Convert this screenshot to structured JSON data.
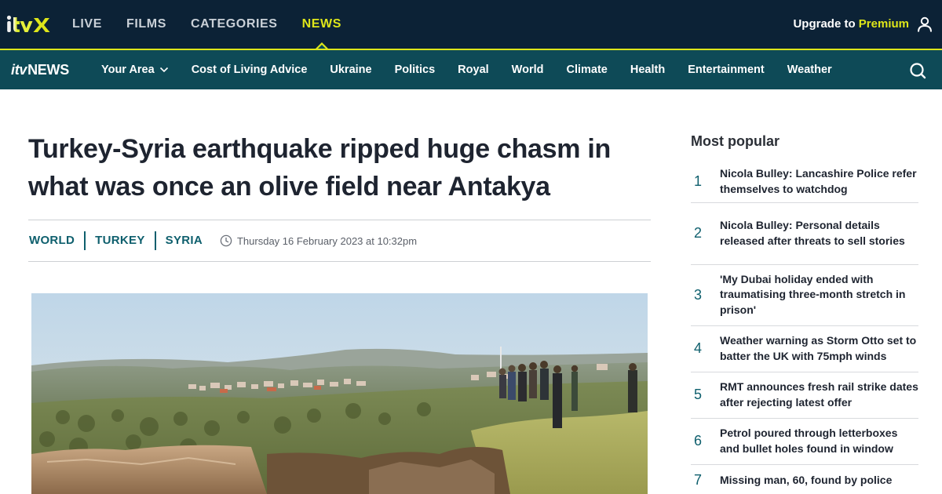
{
  "topbar": {
    "logo_text": "itvX",
    "nav": [
      {
        "label": "LIVE",
        "active": false
      },
      {
        "label": "FILMS",
        "active": false
      },
      {
        "label": "CATEGORIES",
        "active": false
      },
      {
        "label": "NEWS",
        "active": true
      }
    ],
    "upgrade_prefix": "Upgrade to ",
    "upgrade_premium": "Premium",
    "user_icon": "user-icon"
  },
  "newsbar": {
    "logo_itv": "itv",
    "logo_news": "NEWS",
    "items": [
      {
        "label": "Your Area",
        "has_dropdown": true
      },
      {
        "label": "Cost of Living Advice"
      },
      {
        "label": "Ukraine"
      },
      {
        "label": "Politics"
      },
      {
        "label": "Royal"
      },
      {
        "label": "World"
      },
      {
        "label": "Climate"
      },
      {
        "label": "Health"
      },
      {
        "label": "Entertainment"
      },
      {
        "label": "Weather"
      }
    ],
    "search_icon": "search-icon"
  },
  "article": {
    "headline": "Turkey-Syria earthquake ripped huge chasm in what was once an olive field near Antakya",
    "tags": [
      "WORLD",
      "TURKEY",
      "SYRIA"
    ],
    "date": "Thursday 16 February 2023 at 10:32pm",
    "image_icon": "hero-photo"
  },
  "most_popular": {
    "title": "Most popular",
    "items": [
      {
        "rank": "1",
        "text": "Nicola Bulley: Lancashire Police refer themselves to watchdog"
      },
      {
        "rank": "2",
        "text": "Nicola Bulley: Personal details released after threats to sell stories"
      },
      {
        "rank": "3",
        "text": "'My Dubai holiday ended with traumatising three-month stretch in prison'"
      },
      {
        "rank": "4",
        "text": "Weather warning as Storm Otto set to batter the UK with 75mph winds"
      },
      {
        "rank": "5",
        "text": "RMT announces fresh rail strike dates after rejecting latest offer"
      },
      {
        "rank": "6",
        "text": "Petrol poured through letterboxes and bullet holes found in window"
      },
      {
        "rank": "7",
        "text": "Missing man, 60, found by police"
      }
    ]
  },
  "colors": {
    "topbar_bg": "#0c2236",
    "newsbar_bg": "#0e4a57",
    "accent_yellow": "#dee61a",
    "tag_teal": "#0e5f6d"
  }
}
